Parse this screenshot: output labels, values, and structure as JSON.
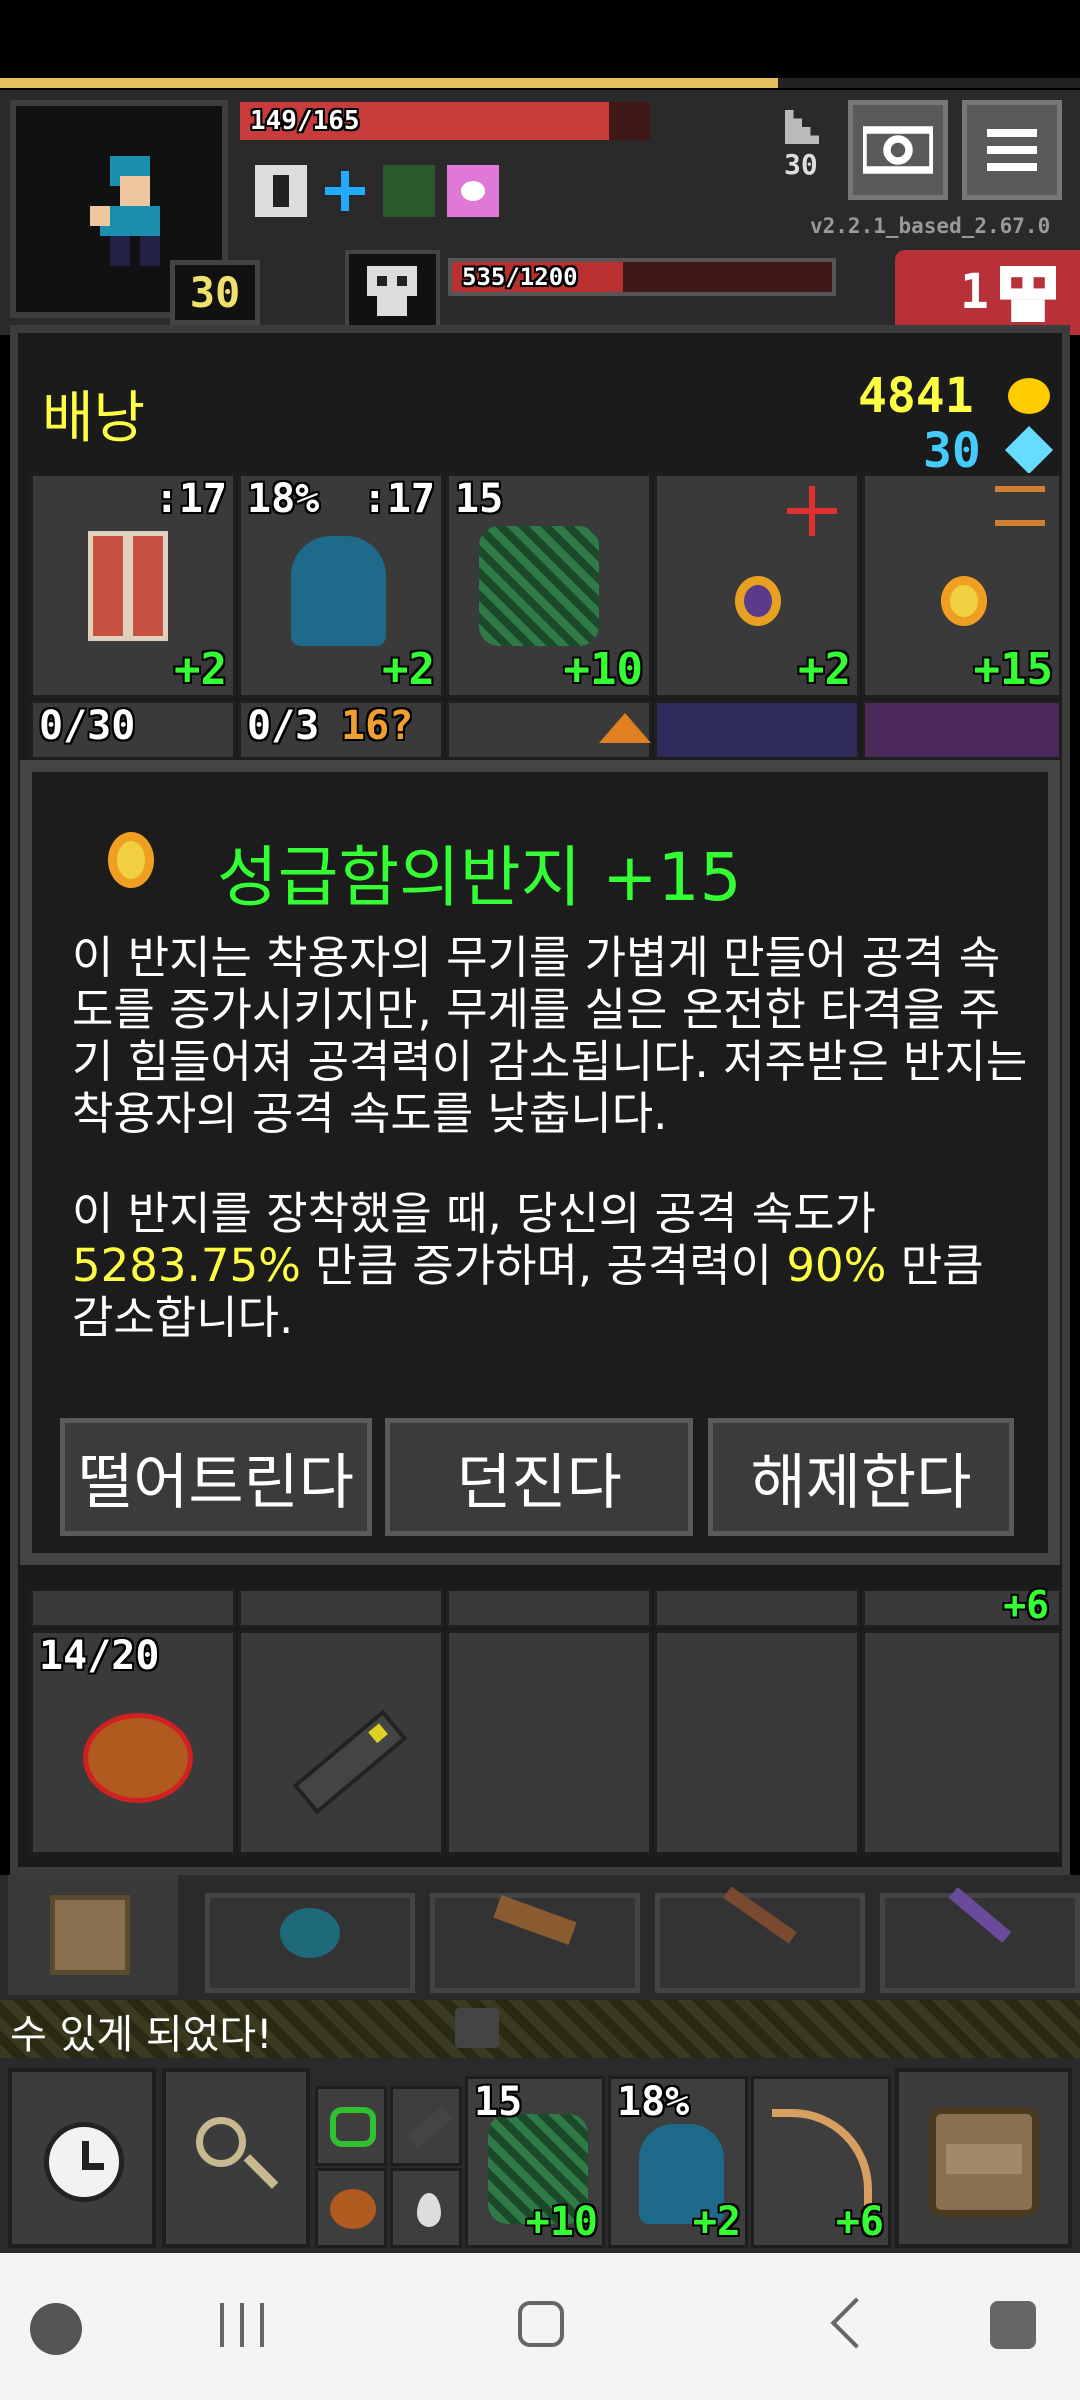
{
  "hero": {
    "hp_text": "149/165",
    "hp_fraction": 0.9,
    "level": "30",
    "depth": "30",
    "version": "v2.2.1_based_2.67.0"
  },
  "enemy": {
    "hp_text": "535/1200",
    "hp_fraction": 0.45,
    "danger_count": "1"
  },
  "backpack": {
    "title": "배낭",
    "gold": "4841",
    "energy": "30",
    "row1": [
      {
        "name": "shield",
        "top_left": ":17",
        "bonus": "+2"
      },
      {
        "name": "cloak",
        "top_left": "18%",
        "top_right": ":17",
        "bonus": "+2"
      },
      {
        "name": "armor",
        "top_left": "15",
        "bonus": "+10"
      },
      {
        "name": "ring-purple",
        "bonus": "+2"
      },
      {
        "name": "ring-gold",
        "bonus": "+15"
      }
    ],
    "row2_labels": [
      "0/30",
      "0/3",
      "16?"
    ],
    "row4_labels": {
      "food_count": "14/20",
      "top_right_bonus": "+6"
    }
  },
  "dialog": {
    "title": "성급함의반지 +15",
    "desc1": "이 반지는 착용자의 무기를 가볍게 만들어 공격 속도를 증가시키지만, 무게를 실은 온전한 타격을 주기 힘들어져 공격력이 감소됩니다. 저주받은 반지는 착용자의 공격 속도를 낮춥니다.",
    "desc2_a": "이 반지를 장착했을 때, 당신의 공격 속도가",
    "speed_value": "5283.75%",
    "desc2_b": "만큼 증가하며, 공격력이",
    "damage_value": "90%",
    "desc2_c": "만큼 감소합니다.",
    "buttons": {
      "drop": "떨어트린다",
      "throw": "던진다",
      "unequip": "해제한다"
    }
  },
  "log": {
    "text": "수 있게 되었다!"
  },
  "quickbar": [
    {
      "name": "armor",
      "count": "15",
      "bonus": "+10"
    },
    {
      "name": "cloak",
      "count": "18%",
      "bonus": "+2"
    },
    {
      "name": "bow",
      "bonus": "+6"
    }
  ],
  "colors": {
    "accent_yellow": "#ffff44",
    "bonus_green": "#33ff33",
    "hp_red": "#c83c3c",
    "gold": "#ffcc00",
    "energy": "#44ccff"
  }
}
